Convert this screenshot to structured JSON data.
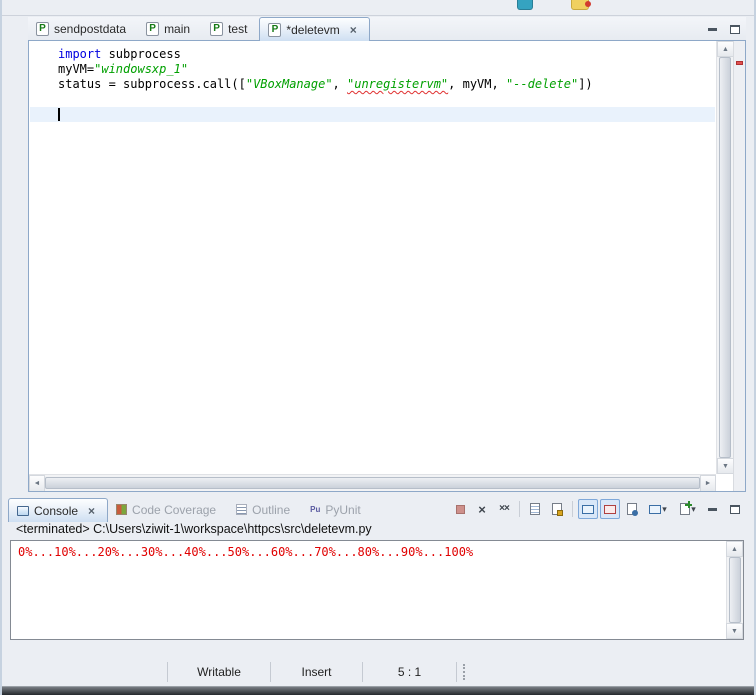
{
  "editor": {
    "tabs": [
      {
        "label": "sendpostdata",
        "active": false
      },
      {
        "label": "main",
        "active": false
      },
      {
        "label": "test",
        "active": false
      },
      {
        "label": "*deletevm",
        "active": true
      }
    ],
    "file_icon_letter": "P",
    "code_lines": [
      {
        "tokens": [
          {
            "text": "import",
            "type": "keyword"
          },
          {
            "text": " subprocess",
            "type": "plain"
          }
        ]
      },
      {
        "tokens": [
          {
            "text": "myVM=",
            "type": "plain"
          },
          {
            "text": "\"windowsxp_1\"",
            "type": "string"
          }
        ]
      },
      {
        "tokens": [
          {
            "text": "status = subprocess.call([",
            "type": "plain"
          },
          {
            "text": "\"VBoxManage\"",
            "type": "string"
          },
          {
            "text": ", ",
            "type": "plain"
          },
          {
            "text": "\"unregistervm\"",
            "type": "string_error"
          },
          {
            "text": ", myVM, ",
            "type": "plain"
          },
          {
            "text": "\"--delete\"",
            "type": "string"
          },
          {
            "text": "])",
            "type": "plain"
          }
        ]
      },
      {
        "tokens": []
      },
      {
        "tokens": [],
        "cursor": true
      }
    ]
  },
  "console": {
    "tabs": [
      {
        "label": "Console",
        "active": true
      },
      {
        "label": "Code Coverage",
        "active": false
      },
      {
        "label": "Outline",
        "active": false
      },
      {
        "label": "PyUnit",
        "active": false
      }
    ],
    "pyunit_icon_text": "Pu",
    "terminated_line": "<terminated> C:\\Users\\ziwit-1\\workspace\\httpcs\\src\\deletevm.py",
    "output_text": "0%...10%...20%...30%...40%...50%...60%...70%...80%...90%...100%"
  },
  "status_bar": {
    "writable": "Writable",
    "insert_mode": "Insert",
    "cursor_position": "5 : 1"
  },
  "icons": {
    "close": "×",
    "remove": "×",
    "remove_all": "××",
    "dropdown": "▾",
    "arrow_up": "▲",
    "arrow_down": "▼",
    "arrow_left": "◄",
    "arrow_right": "►"
  },
  "colors": {
    "keyword": "#0000E0",
    "string": "#00A000",
    "console_error": "#E00000",
    "active_tab_border": "#8EA8C8"
  }
}
